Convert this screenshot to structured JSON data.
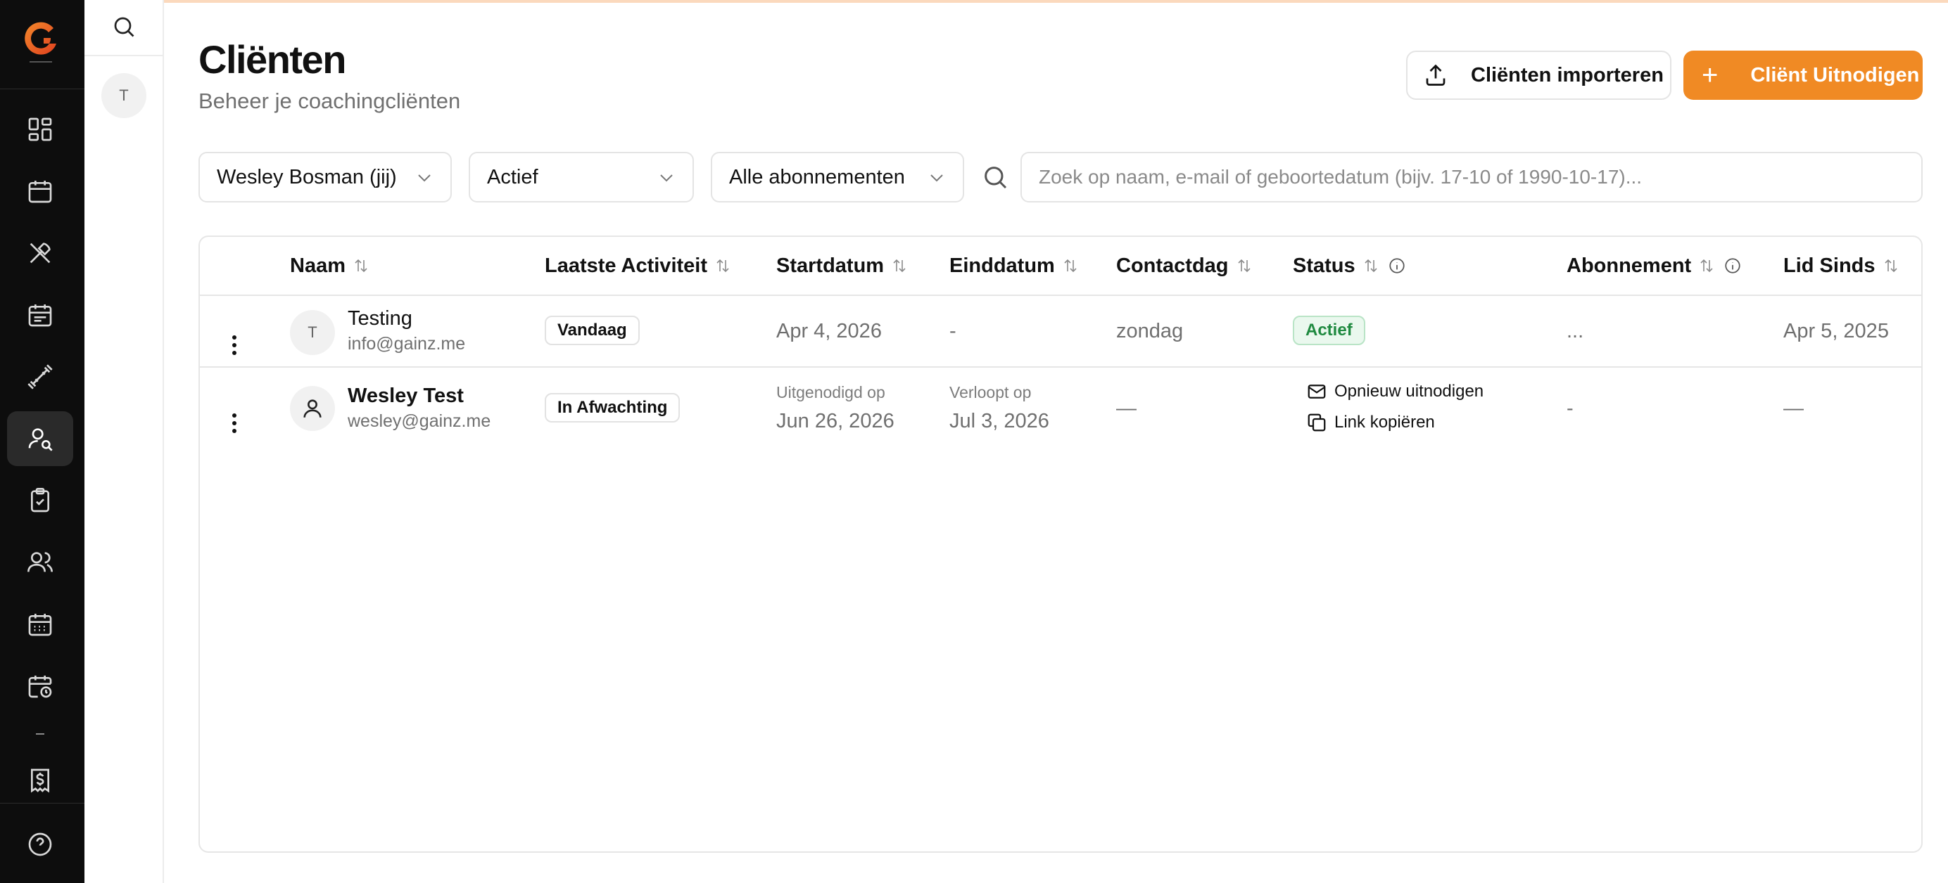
{
  "page": {
    "title": "Cliënten",
    "subtitle": "Beheer je coachingcliënten"
  },
  "actions": {
    "import_label": "Cliënten importeren",
    "invite_label": "Cliënt Uitnodigen",
    "invite_plus": "+"
  },
  "colors": {
    "accent": "#f08a24",
    "sidebar": "#0d0d0d",
    "active_badge_text": "#1f8a40",
    "active_badge_bg": "#eaf8ee"
  },
  "sidebar_secondary": {
    "avatar_initial": "T"
  },
  "filters": {
    "coach": "Wesley Bosman (jij)",
    "status": "Actief",
    "subscription": "Alle abonnementen",
    "search_placeholder": "Zoek op naam, e-mail of geboortedatum (bijv. 17-10 of 1990-10-17)..."
  },
  "table": {
    "columns": [
      "Naam",
      "Laatste Activiteit",
      "Startdatum",
      "Einddatum",
      "Contactdag",
      "Status",
      "Abonnement",
      "Lid Sinds"
    ],
    "rows": [
      {
        "initial": "T",
        "name": "Testing",
        "email": "info@gainz.me",
        "last_activity": "Vandaag",
        "start": "Apr 4, 2026",
        "end": "-",
        "contact_day": "zondag",
        "status": "Actief",
        "subscription": "...",
        "member_since": "Apr 5, 2025"
      },
      {
        "name": "Wesley Test",
        "email": "wesley@gainz.me",
        "last_activity": "In Afwachting",
        "start_label": "Uitgenodigd op",
        "start": "Jun 26, 2026",
        "end_label": "Verloopt op",
        "end": "Jul 3, 2026",
        "contact_day": "—",
        "reinvite_label": "Opnieuw uitnodigen",
        "copy_link_label": "Link kopiëren",
        "subscription": "-",
        "member_since": "—"
      }
    ]
  }
}
